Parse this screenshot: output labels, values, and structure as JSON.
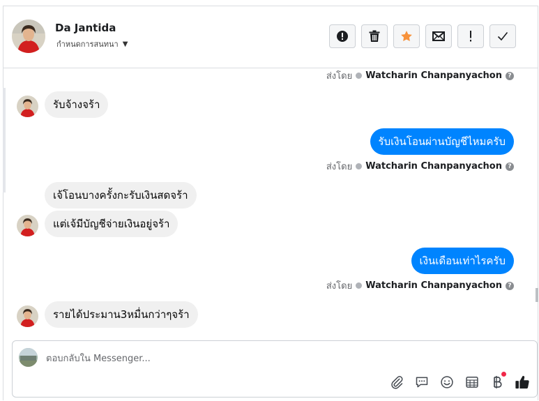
{
  "contact": {
    "name": "Da Jantida",
    "subtitle": "กำหนดการสนทนา"
  },
  "header_actions": [
    {
      "name": "spam-icon",
      "glyph": "!"
    },
    {
      "name": "trash-icon"
    },
    {
      "name": "star-icon",
      "color": "#f7923b"
    },
    {
      "name": "envelope-icon"
    },
    {
      "name": "important-icon",
      "glyph": "!"
    },
    {
      "name": "checkmark-icon"
    }
  ],
  "meta_prefix": "ส่งโดย",
  "messages": [
    {
      "type": "meta",
      "sender": "Watcharin Chanpanyachon"
    },
    {
      "type": "in",
      "text": "รับจ้างจร้า"
    },
    {
      "type": "out",
      "text": "รับเงินโอนผ่านบัญชีไหมครับ"
    },
    {
      "type": "meta",
      "sender": "Watcharin Chanpanyachon"
    },
    {
      "type": "in",
      "text": "เจ้โอนบางครั้งกะรับเงินสดจร้า"
    },
    {
      "type": "in",
      "text": "แต่เจ้มีบัญชีจ่ายเงินอยู่จร้า"
    },
    {
      "type": "out",
      "text": "เงินเดือนเท่าไรครับ"
    },
    {
      "type": "meta",
      "sender": "Watcharin Chanpanyachon"
    },
    {
      "type": "in",
      "text": "รายได้ประมาน3หมื่นกว่าๆจร้า"
    }
  ],
  "composer": {
    "placeholder": "ตอบกลับใน Messenger..."
  },
  "composer_tools": [
    "paperclip-icon",
    "chat-bubble-icon",
    "emoji-icon",
    "table-icon",
    "baht-icon",
    "thumbs-up-icon"
  ],
  "colors": {
    "outgoing_bubble": "#0084ff",
    "incoming_bubble": "#f0f0f0",
    "star": "#f7923b",
    "notification_dot": "#f02849",
    "like": "#1c1e21"
  }
}
